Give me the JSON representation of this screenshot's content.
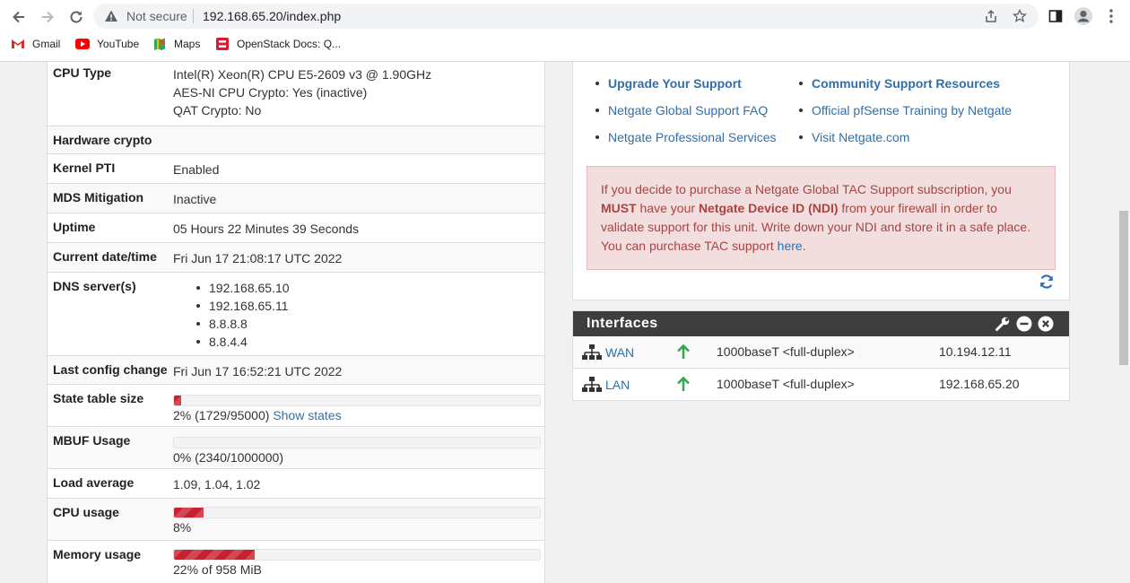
{
  "browser": {
    "security_status": "Not secure",
    "url": "192.168.65.20/index.php",
    "bookmarks": [
      {
        "label": "Gmail"
      },
      {
        "label": "YouTube"
      },
      {
        "label": "Maps"
      },
      {
        "label": "OpenStack Docs: Q..."
      }
    ]
  },
  "system_info": {
    "cpu_type": {
      "label": "CPU Type",
      "lines": [
        "Intel(R) Xeon(R) CPU E5-2609 v3 @ 1.90GHz",
        "AES-NI CPU Crypto: Yes (inactive)",
        "QAT Crypto: No"
      ]
    },
    "hardware_crypto": {
      "label": "Hardware crypto",
      "value": ""
    },
    "kernel_pti": {
      "label": "Kernel PTI",
      "value": "Enabled"
    },
    "mds_mitigation": {
      "label": "MDS Mitigation",
      "value": "Inactive"
    },
    "uptime": {
      "label": "Uptime",
      "value": "05 Hours 22 Minutes 39 Seconds"
    },
    "current_datetime": {
      "label": "Current date/time",
      "value": "Fri Jun 17 21:08:17 UTC 2022"
    },
    "dns_servers": {
      "label": "DNS server(s)",
      "items": [
        "192.168.65.10",
        "192.168.65.11",
        "8.8.8.8",
        "8.8.4.4"
      ]
    },
    "last_config_change": {
      "label": "Last config change",
      "value": "Fri Jun 17 16:52:21 UTC 2022"
    },
    "state_table": {
      "label": "State table size",
      "percent": 2,
      "text": "2% (1729/95000)",
      "link": "Show states"
    },
    "mbuf": {
      "label": "MBUF Usage",
      "percent": 0,
      "text": "0% (2340/1000000)"
    },
    "load_average": {
      "label": "Load average",
      "value": "1.09, 1.04, 1.02"
    },
    "cpu_usage": {
      "label": "CPU usage",
      "percent": 8,
      "text": "8%"
    },
    "memory_usage": {
      "label": "Memory usage",
      "percent": 22,
      "text": "22% of 958 MiB"
    }
  },
  "support": {
    "col1": [
      "Upgrade Your Support",
      "Netgate Global Support FAQ",
      "Netgate Professional Services"
    ],
    "col2": [
      "Community Support Resources",
      "Official pfSense Training by Netgate",
      "Visit Netgate.com"
    ],
    "alert": {
      "t1": "If you decide to purchase a Netgate Global TAC Support subscription, you ",
      "must": "MUST",
      "t2": " have your ",
      "ndi": "Netgate Device ID (NDI)",
      "t3": " from your firewall in order to validate support for this unit. Write down your NDI and store it in a safe place. You can purchase TAC support ",
      "link": "here",
      "t4": "."
    }
  },
  "interfaces": {
    "title": "Interfaces",
    "rows": [
      {
        "name": "WAN",
        "media": "1000baseT <full-duplex>",
        "ip": "10.194.12.11"
      },
      {
        "name": "LAN",
        "media": "1000baseT <full-duplex>",
        "ip": "192.168.65.20"
      }
    ]
  },
  "colors": {
    "accent_link": "#2f6fab",
    "bar_fill": "#c9202e",
    "alert_bg": "#f2dede",
    "header_dark": "#3e3e3e",
    "status_up": "#3aa655"
  }
}
